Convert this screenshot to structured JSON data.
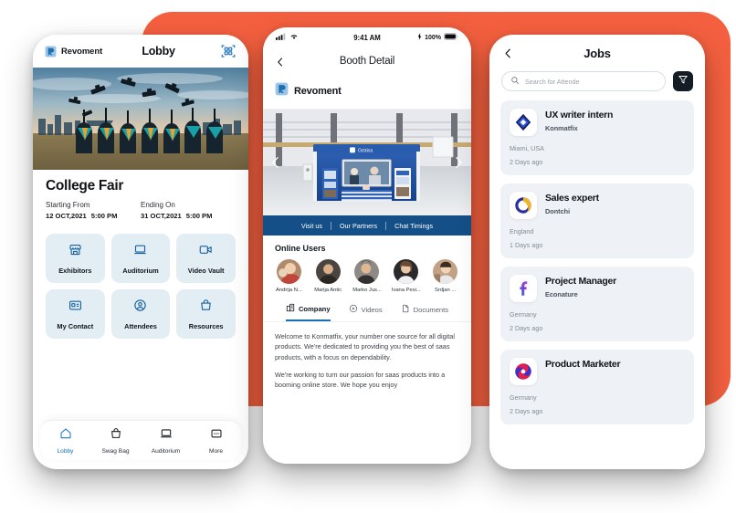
{
  "theme": {
    "backdrop_orange": "#F4603F",
    "brand_blue": "#1a6fb5",
    "booth_bar_blue": "#154f87",
    "tile_bg": "#e3edf4",
    "card_bg": "#eef1f5"
  },
  "phone1": {
    "header": {
      "brand": "Revoment",
      "title": "Lobby",
      "logo_icon": "revoment-logo-icon",
      "qr_icon": "qr-code-icon"
    },
    "hero_image_alt": "graduates-throwing-caps-photo",
    "event": {
      "title": "College Fair",
      "start_label": "Starting From",
      "end_label": "Ending On",
      "start_date": "12 OCT,2021",
      "start_time": "5:00 PM",
      "end_date": "31 OCT,2021",
      "end_time": "5:00 PM"
    },
    "tiles": [
      {
        "label": "Exhibitors",
        "icon": "store-icon"
      },
      {
        "label": "Auditorium",
        "icon": "laptop-icon"
      },
      {
        "label": "Video Vault",
        "icon": "video-camera-icon"
      },
      {
        "label": "My Contact",
        "icon": "contact-card-icon"
      },
      {
        "label": "Attendees",
        "icon": "user-circle-icon"
      },
      {
        "label": "Resources",
        "icon": "bag-icon"
      }
    ],
    "tabbar": [
      {
        "label": "Lobby",
        "icon": "home-icon",
        "active": true
      },
      {
        "label": "Swag Bag",
        "icon": "bag-icon",
        "active": false
      },
      {
        "label": "Auditorium",
        "icon": "laptop-icon",
        "active": false
      },
      {
        "label": "More",
        "icon": "more-dots-icon",
        "active": false
      }
    ]
  },
  "phone2": {
    "statusbar": {
      "signal_icon": "cellular-signal-icon",
      "carrier": "",
      "wifi_icon": "wifi-icon",
      "time": "9:41 AM",
      "battery_text": "100%",
      "battery_icon": "battery-full-icon",
      "charging_icon": "lightning-bolt-icon"
    },
    "navbar": {
      "back_icon": "chevron-left-icon",
      "title": "Booth Detail"
    },
    "brandbar": {
      "logo_icon": "revoment-logo-icon",
      "name": "Revoment"
    },
    "booth": {
      "image_alt": "virtual-exhibition-booth-render",
      "prev_icon": "chevron-left-icon",
      "next_icon": "chevron-right-icon"
    },
    "booth_tabs": [
      "Visit us",
      "Our Partners",
      "Chat Timings"
    ],
    "online_users_heading": "Online Users",
    "online_users": [
      {
        "name": "Andrija N..."
      },
      {
        "name": "Marija Antic"
      },
      {
        "name": "Marko Jus..."
      },
      {
        "name": "Ivana Pesi..."
      },
      {
        "name": "Srdjan ..."
      }
    ],
    "content_tabs": [
      {
        "label": "Company",
        "icon": "company-icon",
        "active": true
      },
      {
        "label": "Videos",
        "icon": "play-icon",
        "active": false
      },
      {
        "label": "Documents",
        "icon": "document-icon",
        "active": false
      }
    ],
    "paragraphs": [
      "Welcome to Konmatfix, your number one source for all digital products. We're dedicated to providing you the best of saas products, with a focus on dependability.",
      "We're working to turn our passion for saas products into a booming online store. We hope you enjoy"
    ]
  },
  "phone3": {
    "navbar": {
      "back_icon": "chevron-left-icon",
      "title": "Jobs"
    },
    "search": {
      "placeholder": "Search for Attende",
      "icon": "search-icon",
      "value": ""
    },
    "filter_button": {
      "icon": "filter-funnel-icon"
    },
    "jobs": [
      {
        "title": "UX writer intern",
        "company": "Konmatfix",
        "location": "Miami, USA",
        "age": "2 Days ago",
        "logo": "diamond-logo-icon"
      },
      {
        "title": "Sales expert",
        "company": "Dontchi",
        "location": "England",
        "age": "1 Days ago",
        "logo": "ring-o-logo-icon"
      },
      {
        "title": "Project Manager",
        "company": "Econature",
        "location": "Germany",
        "age": "2 Days ago",
        "logo": "gradient-f-logo-icon"
      },
      {
        "title": "Product Marketer",
        "company": "",
        "location": "Germany",
        "age": "2 Days ago",
        "logo": "swirl-logo-icon"
      }
    ]
  }
}
